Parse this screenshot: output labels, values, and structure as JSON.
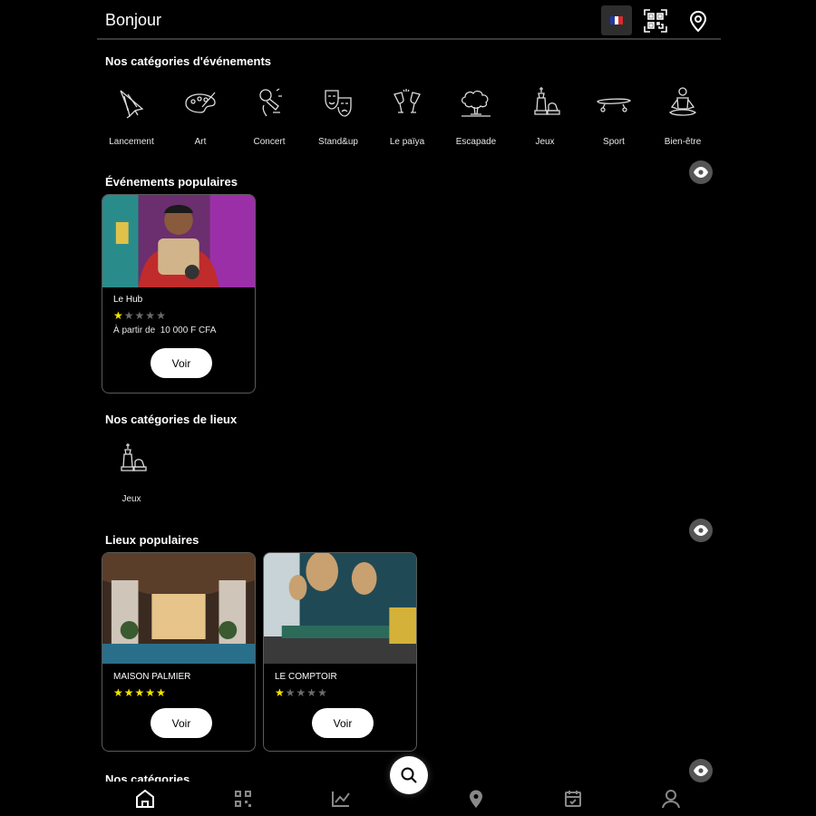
{
  "header": {
    "greeting": "Bonjour",
    "language": "fr",
    "flag_colors": [
      "#1f3aa3",
      "#ffffff",
      "#d92a2a"
    ]
  },
  "event_categories": {
    "title": "Nos catégories d'événements",
    "items": [
      {
        "label": "Lancement",
        "icon": "rocket-icon"
      },
      {
        "label": "Art",
        "icon": "palette-icon"
      },
      {
        "label": "Concert",
        "icon": "microphone-icon"
      },
      {
        "label": "Stand&up",
        "icon": "theater-masks-icon"
      },
      {
        "label": "Le païya",
        "icon": "cheers-glasses-icon"
      },
      {
        "label": "Escapade",
        "icon": "tree-icon"
      },
      {
        "label": "Jeux",
        "icon": "chess-icon"
      },
      {
        "label": "Sport",
        "icon": "skateboard-icon"
      },
      {
        "label": "Bien-être",
        "icon": "meditation-icon"
      }
    ]
  },
  "popular_events": {
    "title": "Événements populaires",
    "cards": [
      {
        "name": "Le Hub",
        "rating": 1,
        "max_rating": 5,
        "price_prefix": "À partir de",
        "price": "10 000 F CFA",
        "button": "Voir"
      }
    ]
  },
  "place_categories": {
    "title": "Nos catégories de lieux",
    "items": [
      {
        "label": "Jeux",
        "icon": "chess-icon"
      }
    ]
  },
  "popular_places": {
    "title": "Lieux populaires",
    "cards": [
      {
        "name": "MAISON PALMIER",
        "rating": 5,
        "max_rating": 5,
        "button": "Voir"
      },
      {
        "name": "LE COMPTOIR",
        "rating": 1,
        "max_rating": 5,
        "button": "Voir"
      }
    ]
  },
  "next_section": {
    "title": "Nos catégories d'événements"
  },
  "bottom_nav": {
    "active": "home",
    "items": [
      "home-icon",
      "qr-icon",
      "stats-icon",
      "location-icon",
      "calendar-icon",
      "profile-icon"
    ]
  },
  "colors": {
    "background": "#000000",
    "star_on": "#f5e400",
    "star_off": "#6b6b6b",
    "eye_bg": "#555555"
  }
}
